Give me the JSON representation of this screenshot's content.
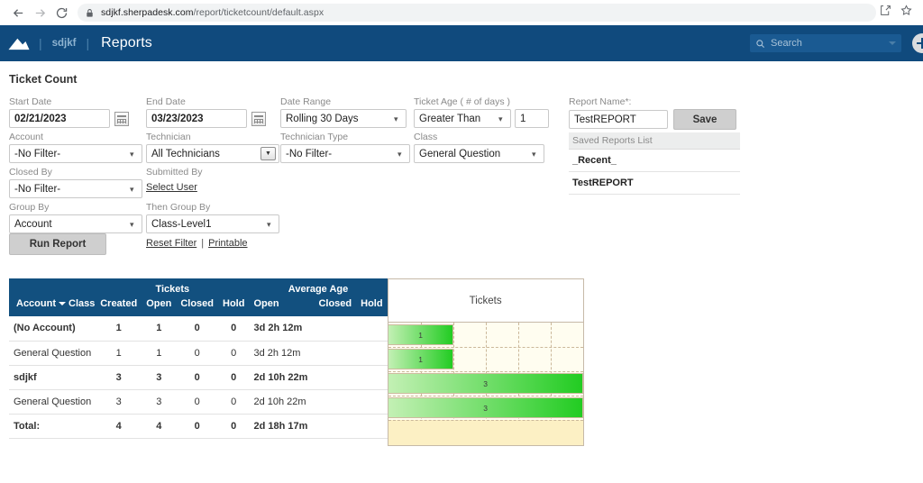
{
  "browser": {
    "back_icon": "arrow-left-icon",
    "forward_icon": "arrow-right-icon",
    "reload_icon": "reload-icon",
    "lock_icon": "lock-icon",
    "url_host": "sdjkf.sherpadesk.com",
    "url_path": "/report/ticketcount/default.aspx",
    "share_icon": "share-icon",
    "bookmark_icon": "star-icon"
  },
  "header": {
    "logo_icon": "mountain-logo-icon",
    "account": "sdjkf",
    "separator": "|",
    "title": "Reports",
    "search": {
      "placeholder": "Search",
      "icon": "search-icon",
      "caret_icon": "chevron-down-icon"
    },
    "add_icon": "plus-circle-icon"
  },
  "page": {
    "title": "Ticket Count"
  },
  "filters": {
    "start_date": {
      "label": "Start Date",
      "value": "02/21/2023",
      "calendar_icon": "calendar-icon"
    },
    "end_date": {
      "label": "End Date",
      "value": "03/23/2023",
      "calendar_icon": "calendar-icon"
    },
    "date_range": {
      "label": "Date Range",
      "value": "Rolling 30 Days"
    },
    "ticket_age": {
      "label": "Ticket Age ( # of days )",
      "operator": "Greater Than",
      "days": "1"
    },
    "account": {
      "label": "Account",
      "value": "-No Filter-"
    },
    "technician": {
      "label": "Technician",
      "value": "All Technicians",
      "button_icon": "chevron-down-icon"
    },
    "technician_type": {
      "label": "Technician Type",
      "value": "-No Filter-"
    },
    "class": {
      "label": "Class",
      "value": "General Question"
    },
    "closed_by": {
      "label": "Closed By",
      "value": "-No Filter-"
    },
    "submitted_by": {
      "label": "Submitted By",
      "link": "Select User"
    },
    "group_by": {
      "label": "Group By",
      "value": "Account"
    },
    "then_group_by": {
      "label": "Then Group By",
      "value": "Class-Level1"
    },
    "run_report": "Run Report",
    "reset_filter": "Reset Filter",
    "pipe": "|",
    "printable": "Printable"
  },
  "report_save": {
    "label": "Report Name*:",
    "value": "TestREPORT",
    "save_button": "Save",
    "saved_list_header": "Saved Reports List",
    "saved_items": [
      "_Recent_",
      "TestREPORT"
    ]
  },
  "table": {
    "group_headers": {
      "tickets": "Tickets",
      "average_age": "Average Age"
    },
    "account_header": "Account",
    "class_header": "Class",
    "sort_icon": "sort-desc-icon",
    "columns": [
      "Created",
      "Open",
      "Closed",
      "Hold",
      "Open",
      "Closed",
      "Hold"
    ],
    "rows": [
      {
        "level": 0,
        "name": "(No Account)",
        "class": "",
        "created": "1",
        "open": "1",
        "closed": "0",
        "hold": "0",
        "age_open": "3d 2h 12m",
        "age_closed": "",
        "age_hold": ""
      },
      {
        "level": 1,
        "name": "",
        "class": "General Question",
        "created": "1",
        "open": "1",
        "closed": "0",
        "hold": "0",
        "age_open": "3d 2h 12m",
        "age_closed": "",
        "age_hold": ""
      },
      {
        "level": 0,
        "name": "sdjkf",
        "class": "",
        "created": "3",
        "open": "3",
        "closed": "0",
        "hold": "0",
        "age_open": "2d 10h 22m",
        "age_closed": "",
        "age_hold": ""
      },
      {
        "level": 1,
        "name": "",
        "class": "General Question",
        "created": "3",
        "open": "3",
        "closed": "0",
        "hold": "0",
        "age_open": "2d 10h 22m",
        "age_closed": "",
        "age_hold": ""
      },
      {
        "level": 2,
        "name": "Total:",
        "class": "",
        "created": "4",
        "open": "4",
        "closed": "0",
        "hold": "0",
        "age_open": "2d 18h 17m",
        "age_closed": "",
        "age_hold": ""
      }
    ]
  },
  "chart_data": {
    "type": "bar",
    "orientation": "horizontal",
    "title": "Tickets",
    "categories": [
      "(No Account)",
      "(No Account) / General Question",
      "sdjkf",
      "sdjkf / General Question",
      "Total:"
    ],
    "values": [
      1,
      1,
      3,
      3,
      null
    ],
    "labels": [
      "1",
      "1",
      "3",
      "3",
      ""
    ],
    "xlim": [
      0,
      3
    ],
    "gridlines": 6,
    "grid": true,
    "bar_color_start": "#c3f0b4",
    "bar_color_end": "#22cc22",
    "plot_background": "#fffdf0",
    "total_row_background": "#fcf0c4"
  }
}
